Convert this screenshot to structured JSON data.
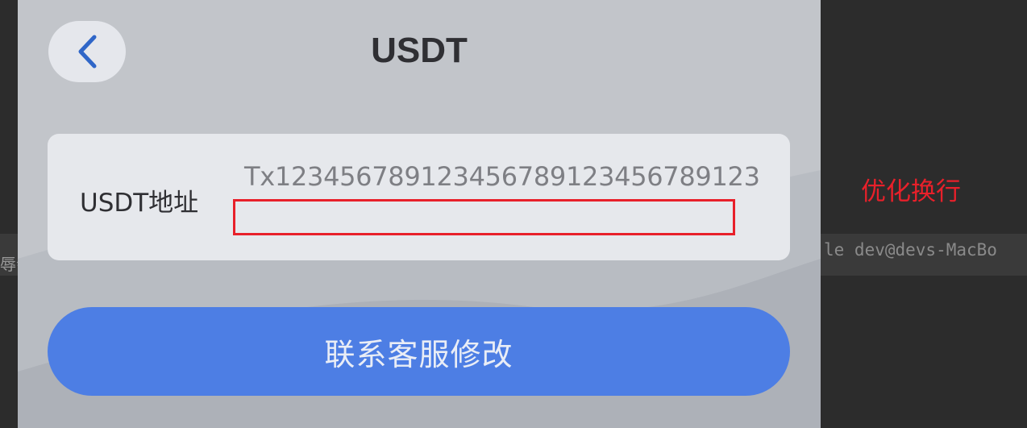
{
  "header": {
    "title": "USDT",
    "back_icon": "chevron-left-icon"
  },
  "address_card": {
    "label": "USDT地址",
    "value": "Tx1234567891234567891234567891​23"
  },
  "contact_button": {
    "label": "联系客服修改"
  },
  "annotation": {
    "text": "优化换行"
  },
  "terminal": {
    "left_text": "辱会",
    "right_text": "le  dev@devs-MacBo"
  },
  "colors": {
    "accent": "#4d7ee4",
    "annotation_red": "#e8202a",
    "screen_bg": "#c2c5ca",
    "back_icon_blue": "#2f66c8"
  }
}
